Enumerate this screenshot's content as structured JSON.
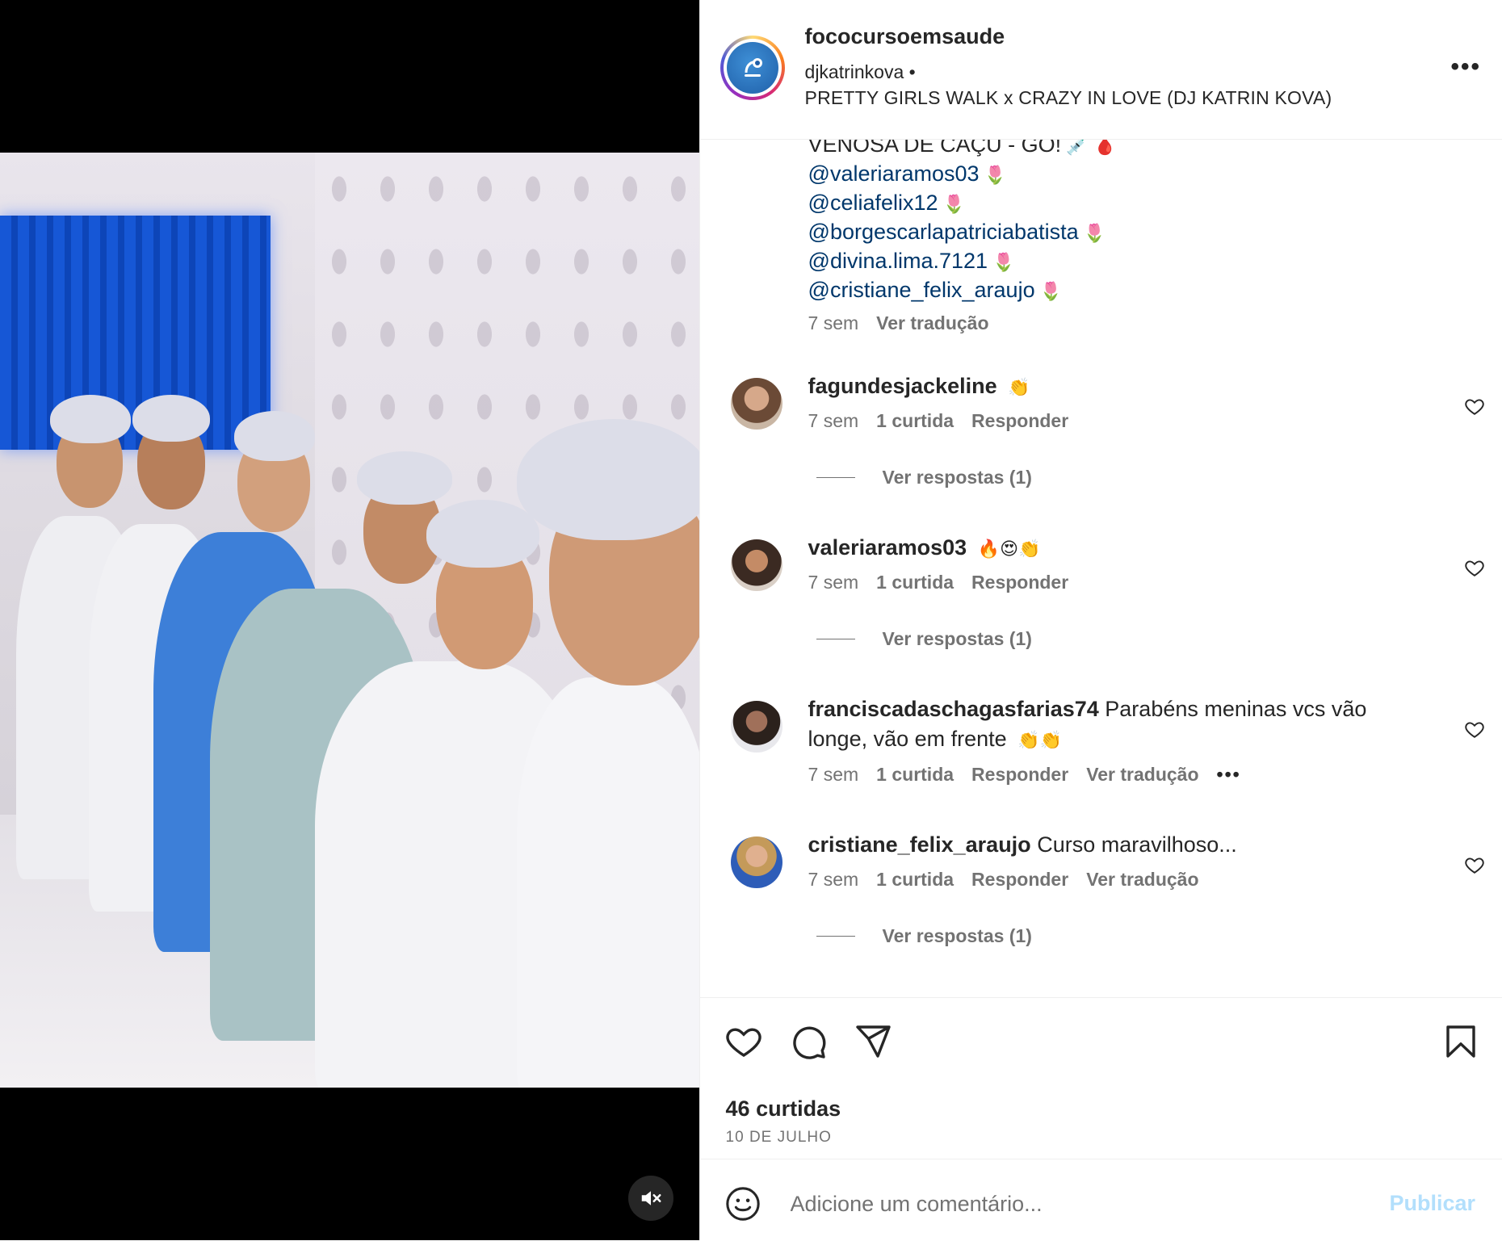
{
  "post": {
    "username": "fococursoemsaude",
    "audio_artist": "djkatrinkova",
    "audio_separator": "•",
    "audio_title": "PRETTY GIRLS WALK x CRAZY IN LOVE (DJ KATRIN KOVA)",
    "more_label": "•••"
  },
  "media": {
    "mute_icon": "speaker-muted-icon"
  },
  "caption": {
    "first_line": "VENOSA DE CAÇU - GO!",
    "first_line_emojis": "💉 🩸",
    "mentions": [
      {
        "handle": "@valeriaramos03",
        "emoji": "🌷"
      },
      {
        "handle": "@celiafelix12",
        "emoji": "🌷"
      },
      {
        "handle": "@borgescarlapatriciabatista",
        "emoji": "🌷"
      },
      {
        "handle": "@divina.lima.7121",
        "emoji": "🌷"
      },
      {
        "handle": "@cristiane_felix_araujo",
        "emoji": "🌷"
      }
    ],
    "time": "7 sem",
    "translate": "Ver tradução"
  },
  "comments": [
    {
      "username": "fagundesjackeline",
      "text": "",
      "emojis": "👏",
      "time": "7 sem",
      "likes": "1 curtida",
      "reply": "Responder",
      "translate": "",
      "replies": "Ver respostas (1)"
    },
    {
      "username": "valeriaramos03",
      "text": "",
      "emojis": "🔥😍👏",
      "time": "7 sem",
      "likes": "1 curtida",
      "reply": "Responder",
      "translate": "",
      "replies": "Ver respostas (1)"
    },
    {
      "username": "franciscadaschagasfarias74",
      "text": "Parabéns meninas vcs vão longe, vão em frente",
      "emojis": "👏👏",
      "time": "7 sem",
      "likes": "1 curtida",
      "reply": "Responder",
      "translate": "Ver tradução",
      "more": "•••",
      "replies": ""
    },
    {
      "username": "cristiane_felix_araujo",
      "text": "Curso maravilhoso...",
      "emojis": "",
      "time": "7 sem",
      "likes": "1 curtida",
      "reply": "Responder",
      "translate": "Ver tradução",
      "replies": "Ver respostas (1)"
    }
  ],
  "actions": {
    "likes_count": "46 curtidas",
    "date": "10 DE JULHO"
  },
  "composer": {
    "placeholder": "Adicione um comentário...",
    "publish_label": "Publicar"
  },
  "colors": {
    "link": "#00376b",
    "muted": "#737373",
    "publish_disabled": "#b2dffc"
  }
}
